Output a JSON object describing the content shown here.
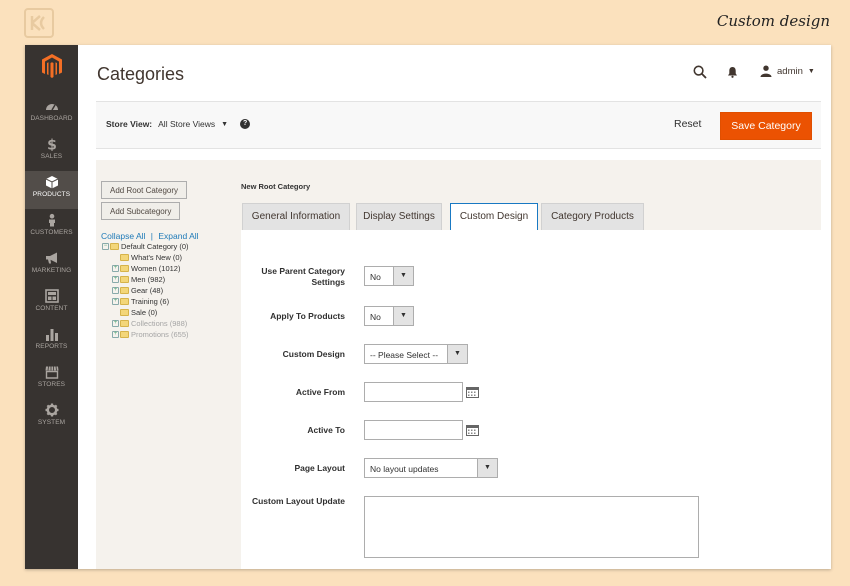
{
  "caption": "Custom design",
  "header": {
    "title": "Categories",
    "user": "admin"
  },
  "nav": [
    {
      "label": "DASHBOARD",
      "icon": "dashboard-icon"
    },
    {
      "label": "SALES",
      "icon": "dollar-icon"
    },
    {
      "label": "PRODUCTS",
      "icon": "box-icon",
      "active": true
    },
    {
      "label": "CUSTOMERS",
      "icon": "person-icon"
    },
    {
      "label": "MARKETING",
      "icon": "megaphone-icon"
    },
    {
      "label": "CONTENT",
      "icon": "layout-icon"
    },
    {
      "label": "REPORTS",
      "icon": "bar-chart-icon"
    },
    {
      "label": "STORES",
      "icon": "store-icon"
    },
    {
      "label": "SYSTEM",
      "icon": "gear-icon"
    }
  ],
  "action_bar": {
    "store_view_label": "Store View:",
    "store_view_value": "All Store Views",
    "help": "?",
    "reset": "Reset",
    "save": "Save Category"
  },
  "tree": {
    "add_root": "Add Root Category",
    "add_sub": "Add Subcategory",
    "collapse": "Collapse All",
    "separator": "|",
    "expand": "Expand All",
    "nodes": [
      {
        "label": "Default Category (0)",
        "toggle": "⊖"
      },
      {
        "label": "What's New (0)",
        "toggle": ""
      },
      {
        "label": "Women (1012)",
        "toggle": "⊕"
      },
      {
        "label": "Men (982)",
        "toggle": "⊕"
      },
      {
        "label": "Gear (48)",
        "toggle": "⊕"
      },
      {
        "label": "Training (6)",
        "toggle": "⊕"
      },
      {
        "label": "Sale (0)",
        "toggle": ""
      },
      {
        "label": "Collections (988)",
        "toggle": "⊕",
        "muted": true
      },
      {
        "label": "Promotions (655)",
        "toggle": "⊕",
        "muted": true
      }
    ]
  },
  "section_title": "New Root Category",
  "tabs": [
    "General Information",
    "Display Settings",
    "Custom Design",
    "Category Products"
  ],
  "active_tab": "Custom Design",
  "form": {
    "use_parent": {
      "label": "Use Parent Category Settings",
      "value": "No"
    },
    "apply_products": {
      "label": "Apply To Products",
      "value": "No"
    },
    "custom_design": {
      "label": "Custom Design",
      "value": "-- Please Select --"
    },
    "active_from": {
      "label": "Active From",
      "value": ""
    },
    "active_to": {
      "label": "Active To",
      "value": ""
    },
    "page_layout": {
      "label": "Page Layout",
      "value": "No layout updates"
    },
    "layout_update": {
      "label": "Custom Layout Update",
      "value": ""
    }
  },
  "colors": {
    "accent": "#eb5202",
    "sidebar": "#373330",
    "link": "#1e7ab8",
    "tab_active_border": "#1979c3"
  }
}
